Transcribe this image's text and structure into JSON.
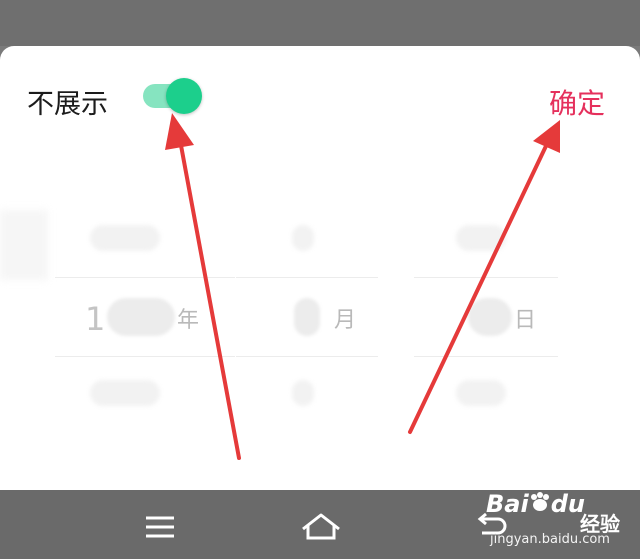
{
  "header": {
    "toggle_label": "不展示",
    "toggle_on": true,
    "confirm_label": "确定"
  },
  "picker": {
    "year": {
      "first_digit": "1",
      "unit": "年"
    },
    "month": {
      "unit": "月"
    },
    "day": {
      "unit": "日"
    }
  },
  "navbar": {
    "icons": [
      "menu-icon",
      "home-icon",
      "back-icon"
    ]
  },
  "watermark": {
    "brand": "Bai",
    "brand_end": "du",
    "product": "经验",
    "url": "jingyan.baidu.com"
  },
  "colors": {
    "accent": "#e5305c",
    "toggle_on": "#1ccf8c",
    "arrow": "#e53a3a"
  }
}
